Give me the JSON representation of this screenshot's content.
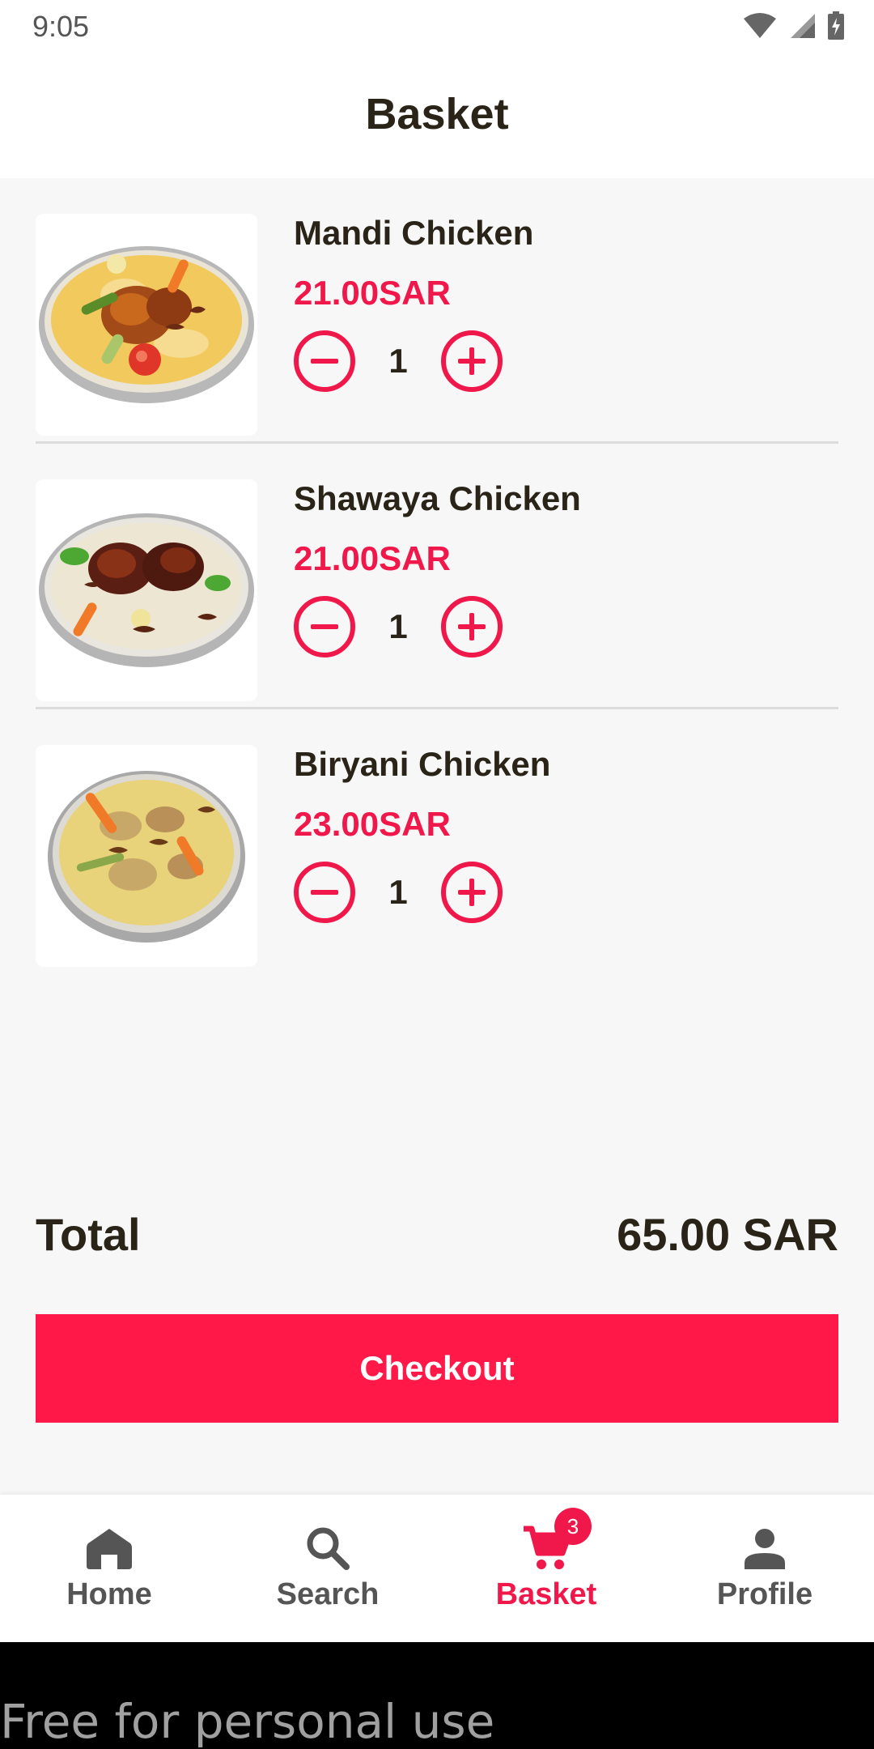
{
  "status_bar": {
    "time": "9:05",
    "icons": [
      "wifi-icon",
      "signal-icon",
      "battery-icon"
    ]
  },
  "header": {
    "title": "Basket"
  },
  "basket": {
    "items": [
      {
        "name": "Mandi Chicken",
        "price": "21.00SAR",
        "quantity": "1",
        "image_icon": "mandi-chicken-image"
      },
      {
        "name": "Shawaya Chicken",
        "price": "21.00SAR",
        "quantity": "1",
        "image_icon": "shawaya-chicken-image"
      },
      {
        "name": "Biryani Chicken",
        "price": "23.00SAR",
        "quantity": "1",
        "image_icon": "biryani-chicken-image"
      }
    ]
  },
  "summary": {
    "total_label": "Total",
    "total_value": "65.00 SAR"
  },
  "checkout": {
    "label": "Checkout"
  },
  "bottom_nav": {
    "items": [
      {
        "label": "Home",
        "icon": "home-icon"
      },
      {
        "label": "Search",
        "icon": "search-icon"
      },
      {
        "label": "Basket",
        "icon": "cart-icon",
        "badge": "3",
        "active": true
      },
      {
        "label": "Profile",
        "icon": "person-icon"
      }
    ]
  },
  "footer": {
    "watermark": "Free for personal use"
  },
  "colors": {
    "accent": "#f0184a",
    "checkout_button": "#ff1848",
    "background": "#f7f7f7",
    "text_dark": "#2a2418",
    "nav_inactive": "#555555"
  }
}
